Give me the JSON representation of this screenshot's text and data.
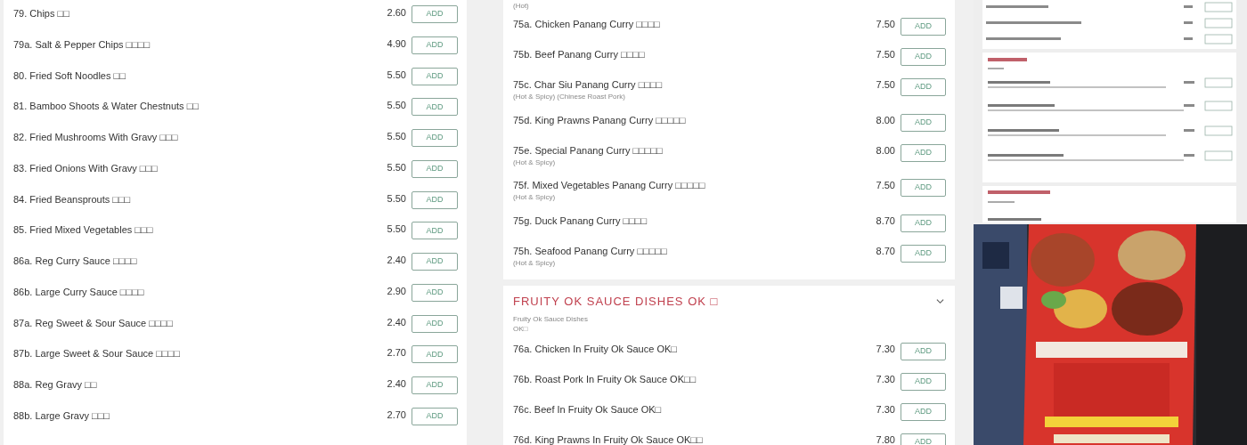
{
  "left_panel": {
    "items": [
      {
        "name": "79. Chips □□",
        "price": "2.60",
        "button": "ADD"
      },
      {
        "name": "79a. Salt & Pepper Chips □□□□",
        "price": "4.90",
        "button": "ADD"
      },
      {
        "name": "80. Fried Soft Noodles □□",
        "price": "5.50",
        "button": "ADD"
      },
      {
        "name": "81. Bamboo Shoots & Water Chestnuts □□",
        "price": "5.50",
        "button": "ADD"
      },
      {
        "name": "82. Fried Mushrooms With Gravy □□□",
        "price": "5.50",
        "button": "ADD"
      },
      {
        "name": "83. Fried Onions With Gravy □□□",
        "price": "5.50",
        "button": "ADD"
      },
      {
        "name": "84. Fried Beansprouts □□□",
        "price": "5.50",
        "button": "ADD"
      },
      {
        "name": "85. Fried Mixed Vegetables □□□",
        "price": "5.50",
        "button": "ADD"
      },
      {
        "name": "86a. Reg Curry Sauce □□□□",
        "price": "2.40",
        "button": "ADD"
      },
      {
        "name": "86b. Large Curry Sauce □□□□",
        "price": "2.90",
        "button": "ADD"
      },
      {
        "name": "87a. Reg Sweet & Sour Sauce □□□□",
        "price": "2.40",
        "button": "ADD"
      },
      {
        "name": "87b. Large Sweet & Sour Sauce □□□□",
        "price": "2.70",
        "button": "ADD"
      },
      {
        "name": "88a. Reg Gravy □□",
        "price": "2.40",
        "button": "ADD"
      },
      {
        "name": "88b. Large Gravy □□□",
        "price": "2.70",
        "button": "ADD"
      }
    ]
  },
  "center_panel": {
    "sections": [
      {
        "lead_note": "(Hot)",
        "items": [
          {
            "name": "75a. Chicken Panang Curry □□□□",
            "price": "7.50",
            "button": "ADD"
          },
          {
            "name": "75b. Beef Panang Curry □□□□",
            "price": "7.50",
            "button": "ADD"
          },
          {
            "name": "75c. Char Siu Panang Curry □□□□",
            "note": "(Hot & Spicy) (Chinese Roast Pork)",
            "price": "7.50",
            "button": "ADD"
          },
          {
            "name": "75d. King Prawns Panang Curry □□□□□",
            "price": "8.00",
            "button": "ADD"
          },
          {
            "name": "75e. Special Panang Curry □□□□□",
            "note": "(Hot & Spicy)",
            "price": "8.00",
            "button": "ADD"
          },
          {
            "name": "75f. Mixed Vegetables Panang Curry □□□□□",
            "note": "(Hot & Spicy)",
            "price": "7.50",
            "button": "ADD"
          },
          {
            "name": "75g. Duck Panang Curry □□□□",
            "price": "8.70",
            "button": "ADD"
          },
          {
            "name": "75h. Seafood Panang Curry □□□□□",
            "note": "(Hot & Spicy)",
            "price": "8.70",
            "button": "ADD"
          }
        ]
      },
      {
        "title": "FRUITY OK SAUCE DISHES OK □",
        "expanded": true,
        "description": [
          "Fruity Ok Sauce Dishes",
          "OK□"
        ],
        "items": [
          {
            "name": "76a. Chicken In Fruity Ok Sauce OK□",
            "price": "7.30",
            "button": "ADD"
          },
          {
            "name": "76b. Roast Pork In Fruity Ok Sauce OK□□",
            "price": "7.30",
            "button": "ADD"
          },
          {
            "name": "76c. Beef In Fruity Ok Sauce OK□",
            "price": "7.30",
            "button": "ADD"
          },
          {
            "name": "76d. King Prawns In Fruity Ok Sauce OK□□",
            "price": "7.80",
            "button": "ADD"
          }
        ]
      }
    ]
  }
}
